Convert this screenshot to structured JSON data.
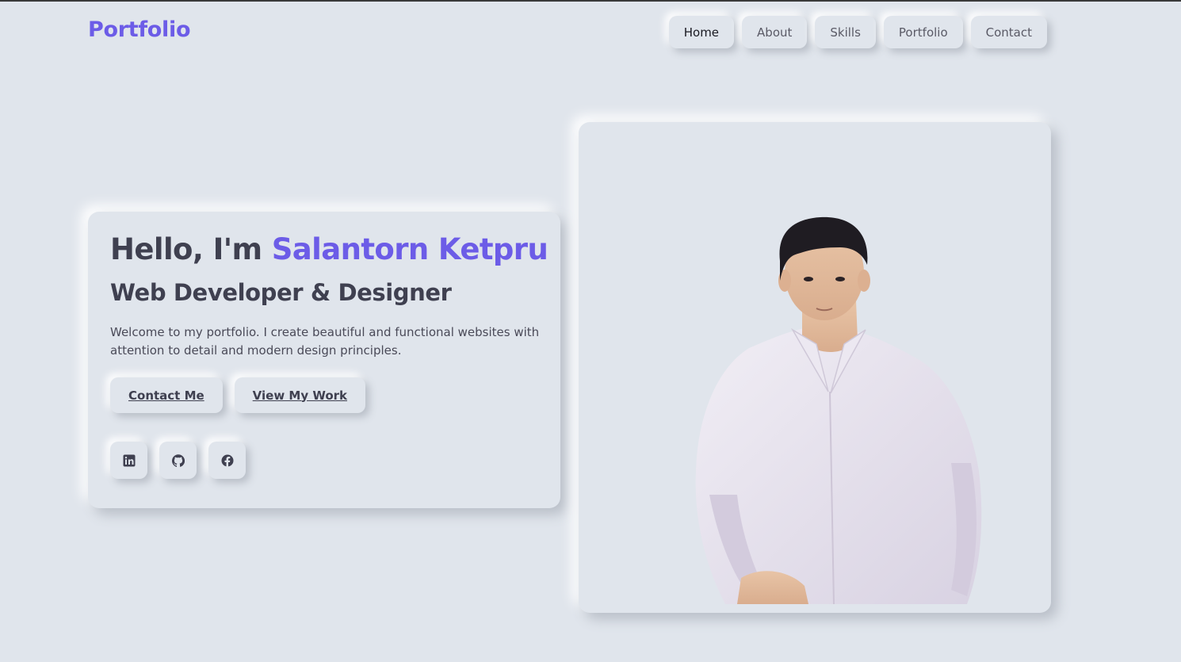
{
  "brand": {
    "logo": "Portfolio",
    "accent_color": "#6c5ce7",
    "background_color": "#e0e5ec"
  },
  "nav": {
    "items": [
      {
        "label": "Home",
        "active": true
      },
      {
        "label": "About",
        "active": false
      },
      {
        "label": "Skills",
        "active": false
      },
      {
        "label": "Portfolio",
        "active": false
      },
      {
        "label": "Contact",
        "active": false
      }
    ]
  },
  "hero": {
    "greeting_prefix": "Hello, I'm",
    "name": "Salantorn Ketpru",
    "role": "Web Developer & Designer",
    "intro": "Welcome to my portfolio. I create beautiful and functional websites with attention to detail and modern design principles.",
    "buttons": {
      "contact": "Contact Me",
      "work": "View My Work"
    },
    "social": [
      {
        "icon": "linkedin-icon"
      },
      {
        "icon": "github-icon"
      },
      {
        "icon": "facebook-icon"
      }
    ]
  },
  "photo": {
    "subject": "portrait-photo"
  }
}
